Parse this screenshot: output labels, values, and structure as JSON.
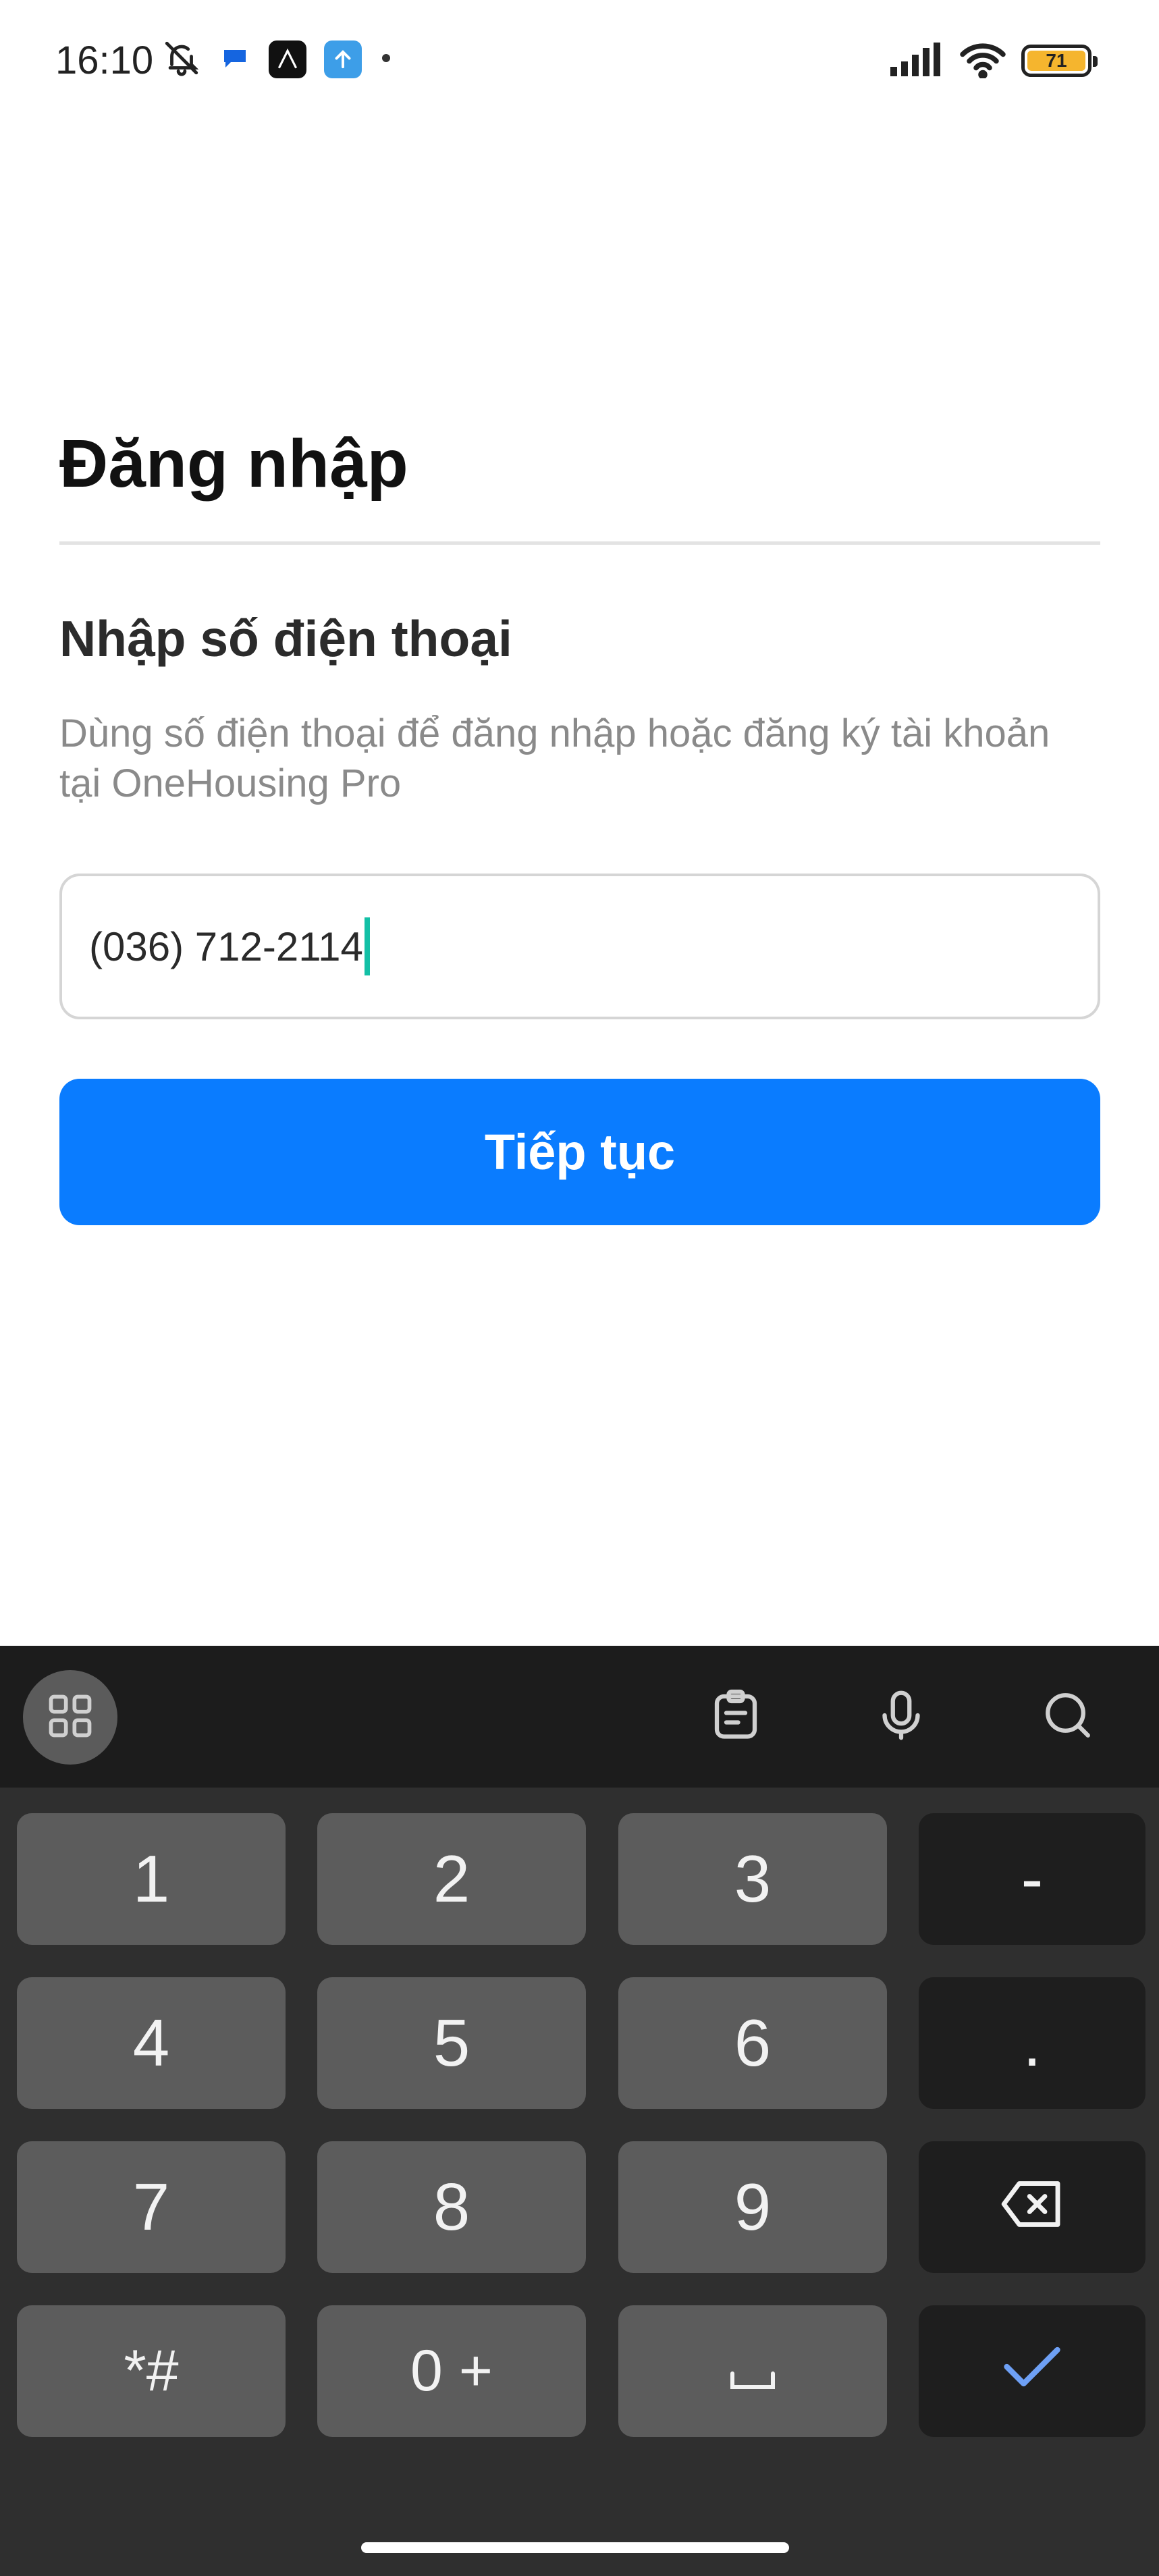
{
  "status_bar": {
    "time": "16:10",
    "icons": [
      "bell-off-icon",
      "chat-bubble-icon",
      "app-icon-dark",
      "upload-app-icon",
      "dot-icon"
    ],
    "right_icons": [
      "signal-icon",
      "wifi-icon",
      "battery-icon"
    ],
    "battery_level": "71"
  },
  "login": {
    "title": "Đăng nhập",
    "heading": "Nhập số điện thoại",
    "description": "Dùng số điện thoại để đăng nhập hoặc đăng ký tài khoản tại OneHousing Pro",
    "phone_value": "(036) 712-2114",
    "continue_label": "Tiếp tục"
  },
  "keyboard": {
    "toolbar": [
      "grid-menu-icon",
      "clipboard-icon",
      "microphone-icon",
      "search-icon"
    ],
    "keys": {
      "k1": "1",
      "k2": "2",
      "k3": "3",
      "dash": "-",
      "k4": "4",
      "k5": "5",
      "k6": "6",
      "dot": ".",
      "k7": "7",
      "k8": "8",
      "k9": "9",
      "symbols": "*#",
      "zero_plus": "0 +"
    },
    "icons": [
      "backspace-icon",
      "space-icon",
      "confirm-check-icon"
    ]
  },
  "colors": {
    "accent": "#0a7cff",
    "caret": "#13c0a6",
    "keyboard_bg": "#2f2f2f",
    "key_bg": "#5c5c5c",
    "fn_key_bg": "#1e1e1e"
  }
}
